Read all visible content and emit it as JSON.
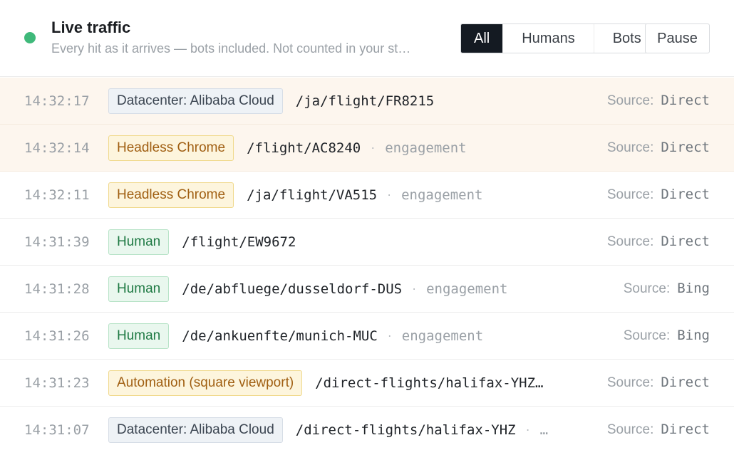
{
  "header": {
    "title": "Live traffic",
    "subtitle": "Every hit as it arrives — bots included. Not counted in your st…",
    "status_color": "#3fb97a",
    "filters": [
      "All",
      "Humans",
      "Bots"
    ],
    "active_filter": "All",
    "pause_label": "Pause"
  },
  "source_label": "Source:",
  "rows": [
    {
      "time": "14:32:17",
      "badge": "Datacenter: Alibaba Cloud",
      "kind": "dc",
      "path": "/ja/flight/FR8215",
      "sep": "",
      "tag": "",
      "source": "Direct",
      "highlight": true
    },
    {
      "time": "14:32:14",
      "badge": "Headless Chrome",
      "kind": "bot",
      "path": "/flight/AC8240",
      "sep": "·",
      "tag": "engagement",
      "source": "Direct",
      "highlight": true
    },
    {
      "time": "14:32:11",
      "badge": "Headless Chrome",
      "kind": "bot",
      "path": "/ja/flight/VA515",
      "sep": "·",
      "tag": "engagement",
      "source": "Direct",
      "highlight": false
    },
    {
      "time": "14:31:39",
      "badge": "Human",
      "kind": "human",
      "path": "/flight/EW9672",
      "sep": "",
      "tag": "",
      "source": "Direct",
      "highlight": false
    },
    {
      "time": "14:31:28",
      "badge": "Human",
      "kind": "human",
      "path": "/de/abfluege/dusseldorf-DUS",
      "sep": "·",
      "tag": "engagement",
      "source": "Bing",
      "highlight": false
    },
    {
      "time": "14:31:26",
      "badge": "Human",
      "kind": "human",
      "path": "/de/ankuenfte/munich-MUC",
      "sep": "·",
      "tag": "engagement",
      "source": "Bing",
      "highlight": false
    },
    {
      "time": "14:31:23",
      "badge": "Automation (square viewport)",
      "kind": "bot",
      "path": "/direct-flights/halifax-YHZ…",
      "sep": "",
      "tag": "",
      "source": "Direct",
      "highlight": false
    },
    {
      "time": "14:31:07",
      "badge": "Datacenter: Alibaba Cloud",
      "kind": "dc",
      "path": "/direct-flights/halifax-YHZ",
      "sep": "·",
      "tag": "…",
      "source": "Direct",
      "highlight": false
    }
  ]
}
